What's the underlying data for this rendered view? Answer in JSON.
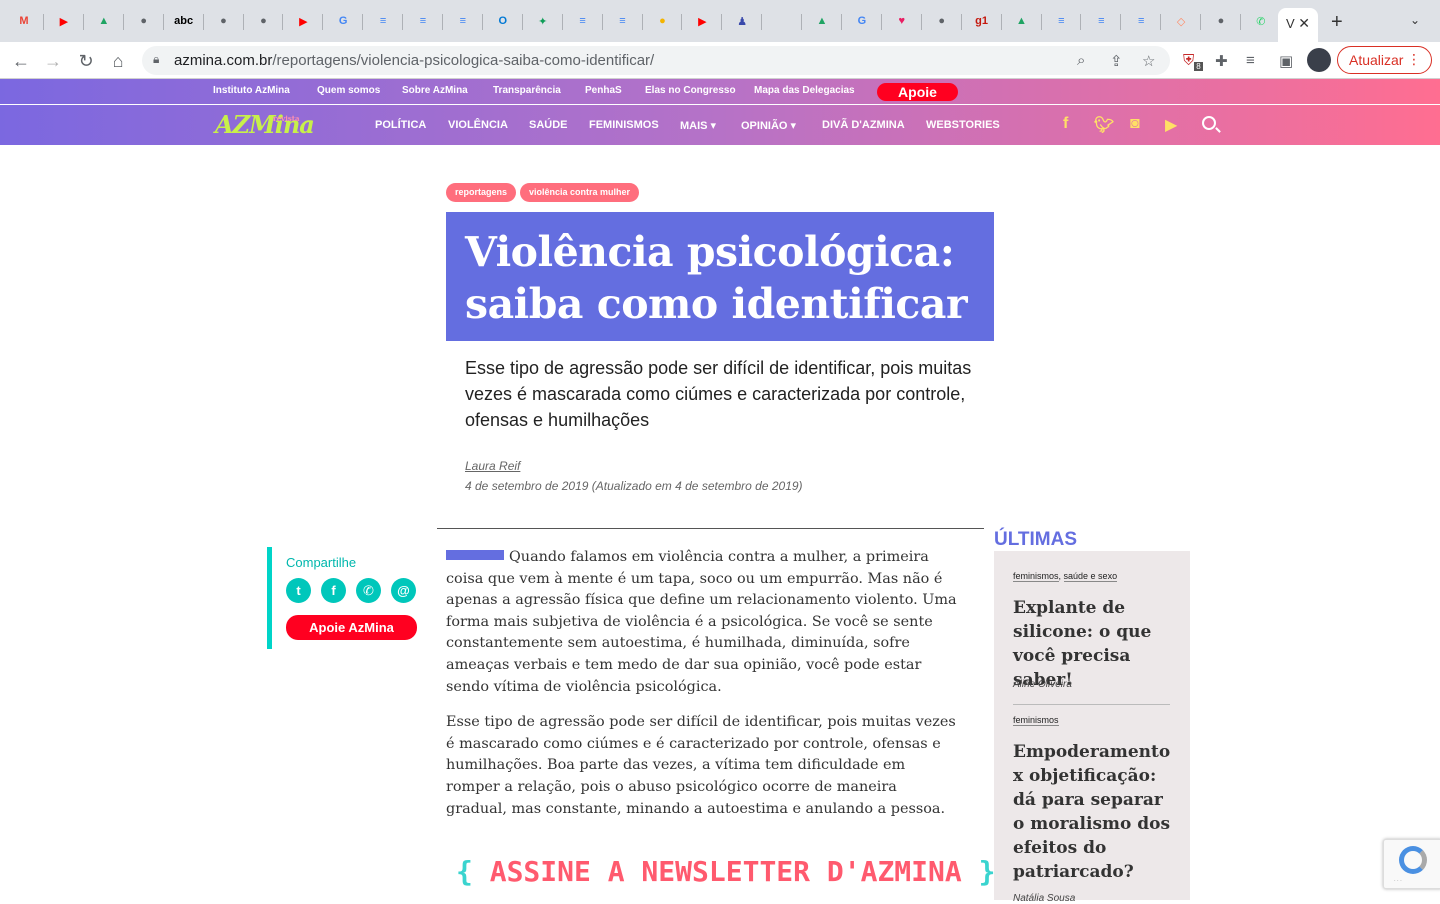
{
  "browser": {
    "tabs": [
      {
        "icon": "gmail-icon",
        "glyph": "M",
        "color": "#ea4335"
      },
      {
        "icon": "youtube-icon",
        "glyph": "▶",
        "color": "#ff0000"
      },
      {
        "icon": "google-drive-icon",
        "glyph": "▲",
        "color": "#1fa463"
      },
      {
        "icon": "globe-icon",
        "glyph": "●",
        "color": "#5f6368"
      },
      {
        "icon": "abc-icon",
        "glyph": "abc",
        "color": "#000000"
      },
      {
        "icon": "globe-icon",
        "glyph": "●",
        "color": "#5f6368"
      },
      {
        "icon": "globe-icon",
        "glyph": "●",
        "color": "#5f6368"
      },
      {
        "icon": "youtube-icon",
        "glyph": "▶",
        "color": "#ff0000"
      },
      {
        "icon": "google-icon",
        "glyph": "G",
        "color": "#4285f4"
      },
      {
        "icon": "google-docs-icon",
        "glyph": "≡",
        "color": "#4285f4"
      },
      {
        "icon": "google-docs-icon",
        "glyph": "≡",
        "color": "#4285f4"
      },
      {
        "icon": "google-docs-icon",
        "glyph": "≡",
        "color": "#4285f4"
      },
      {
        "icon": "outlook-icon",
        "glyph": "O",
        "color": "#0078d4"
      },
      {
        "icon": "sparkle-icon",
        "glyph": "✦",
        "color": "#0f9d58"
      },
      {
        "icon": "google-docs-icon",
        "glyph": "≡",
        "color": "#4285f4"
      },
      {
        "icon": "google-docs-icon",
        "glyph": "≡",
        "color": "#4285f4"
      },
      {
        "icon": "medal-icon",
        "glyph": "●",
        "color": "#f4b400"
      },
      {
        "icon": "youtube-icon",
        "glyph": "▶",
        "color": "#ff0000"
      },
      {
        "icon": "figure-icon",
        "glyph": "♟",
        "color": "#3949ab"
      },
      {
        "icon": "blank-icon",
        "glyph": "",
        "color": "#dee1e6"
      },
      {
        "icon": "google-drive-icon",
        "glyph": "▲",
        "color": "#1fa463"
      },
      {
        "icon": "google-icon",
        "glyph": "G",
        "color": "#4285f4"
      },
      {
        "icon": "heart-icon",
        "glyph": "♥",
        "color": "#e91e63"
      },
      {
        "icon": "globe-icon",
        "glyph": "●",
        "color": "#5f6368"
      },
      {
        "icon": "g1-icon",
        "glyph": "g1",
        "color": "#c4170c"
      },
      {
        "icon": "google-drive-icon",
        "glyph": "▲",
        "color": "#1fa463"
      },
      {
        "icon": "google-docs-icon",
        "glyph": "≡",
        "color": "#4285f4"
      },
      {
        "icon": "google-docs-icon",
        "glyph": "≡",
        "color": "#4285f4"
      },
      {
        "icon": "google-docs-icon",
        "glyph": "≡",
        "color": "#4285f4"
      },
      {
        "icon": "bag-icon",
        "glyph": "◇",
        "color": "#ff8a65"
      },
      {
        "icon": "globe-icon",
        "glyph": "●",
        "color": "#5f6368"
      },
      {
        "icon": "whatsapp-icon",
        "glyph": "✆",
        "color": "#25d366"
      }
    ],
    "active_tab_label": "V",
    "url_domain": "azmina.com.br",
    "url_path": "/reportagens/violencia-psicologica-saiba-como-identificar/",
    "update_label": "Atualizar",
    "extension_badge": "8"
  },
  "site": {
    "top_links": [
      "Instituto AzMina",
      "Quem somos",
      "Sobre AzMina",
      "Transparência",
      "PenhaS",
      "Elas no Congresso",
      "Mapa das Delegacias"
    ],
    "apoie_label": "Apoie",
    "logo_text": "AZMina",
    "logo_small": "revista",
    "main_links": [
      "POLÍTICA",
      "VIOLÊNCIA",
      "SAÚDE",
      "FEMINISMOS",
      "MAIS",
      "OPINIÃO",
      "DIVÃ D'AZMINA",
      "WEBSTORIES"
    ],
    "mais_label": "MAIS ▾",
    "opiniao_label": "OPINIÃO ▾",
    "colors": {
      "accent": "#646ee0",
      "pink": "#ff6e91",
      "red": "#ff0020",
      "teal": "#00c7bb"
    }
  },
  "article": {
    "tags": [
      "reportagens",
      "violência contra mulher"
    ],
    "title_line1": "Violência psicológica:",
    "title_line2": "saiba como identificar",
    "subtitle": "Esse tipo de agressão pode ser difícil de identificar, pois muitas vezes é mascarada como ciúmes e caracterizada por controle, ofensas e humilhações",
    "author": "Laura Reif",
    "date": "4 de setembro de 2019 (Atualizado em 4 de setembro de 2019)",
    "paragraph1": "Quando falamos em violência contra a mulher, a primeira coisa que vem à mente é um tapa, soco ou um empurrão. Mas não é apenas a agressão física que define um relacionamento violento. Uma forma mais subjetiva de violência é a psicológica. Se você se sente constantemente sem autoestima, é humilhada, diminuída, sofre ameaças verbais e tem medo de dar sua opinião, você pode estar sendo vítima de violência psicológica.",
    "paragraph2": "Esse tipo de agressão pode ser difícil de identificar, pois muitas vezes é mascarado como ciúmes e é caracterizado por controle, ofensas e humilhações. Boa parte das vezes, a vítima tem dificuldade em romper a relação, pois o abuso psicológico ocorre de maneira gradual, mas constante, minando a autoestima e anulando a pessoa.",
    "newsletter_text": "ASSINE A NEWSLETTER D'AZMINA"
  },
  "share": {
    "label": "Compartilhe",
    "buttons": [
      "twitter-icon",
      "facebook-icon",
      "whatsapp-icon",
      "email-icon"
    ],
    "apoie_label": "Apoie AzMina"
  },
  "ultimas": {
    "heading": "ÚLTIMAS",
    "items": [
      {
        "tag1": "feminismos",
        "tag2": "saúde e sexo",
        "title": "Explante de silicone: o que você precisa saber!",
        "author": "Aline Oliveira"
      },
      {
        "tag1": "feminismos",
        "title": "Empoderamento x objetificação: dá para separar o moralismo dos efeitos do patriarcado?",
        "author": "Natália Sousa"
      }
    ]
  }
}
